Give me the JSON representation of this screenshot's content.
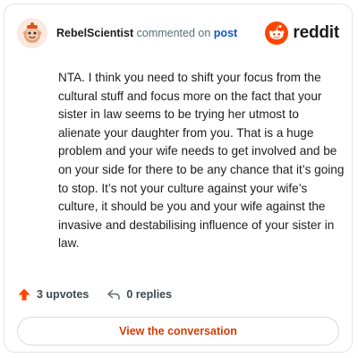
{
  "header": {
    "username": "RebelScientist",
    "action_text": "commented on",
    "post_link": "post",
    "brand": "reddit"
  },
  "comment": {
    "text": "NTA. I think you need to shift your focus from the cultural stuff and focus more on the fact that your sister in law seems to be trying her utmost to alienate your daughter from you. That is a huge problem and your wife needs to get involved and be on your side for there to be any chance that it’s going to stop. It’s not your culture against your wife’s culture, it should be you and your wife against the invasive and destabilising influence of your sister in law."
  },
  "actions": {
    "upvotes": "3 upvotes",
    "replies": "0 replies"
  },
  "cta": {
    "label": "View the conversation"
  },
  "colors": {
    "brand_orange": "#ff4500",
    "link_blue": "#0a58c7",
    "cta_text": "#d93a00"
  },
  "icons": {
    "avatar": "snoo-avatar-icon",
    "brand": "reddit-logo-icon",
    "upvote": "upvote-arrow-icon",
    "reply": "reply-arrow-icon"
  }
}
